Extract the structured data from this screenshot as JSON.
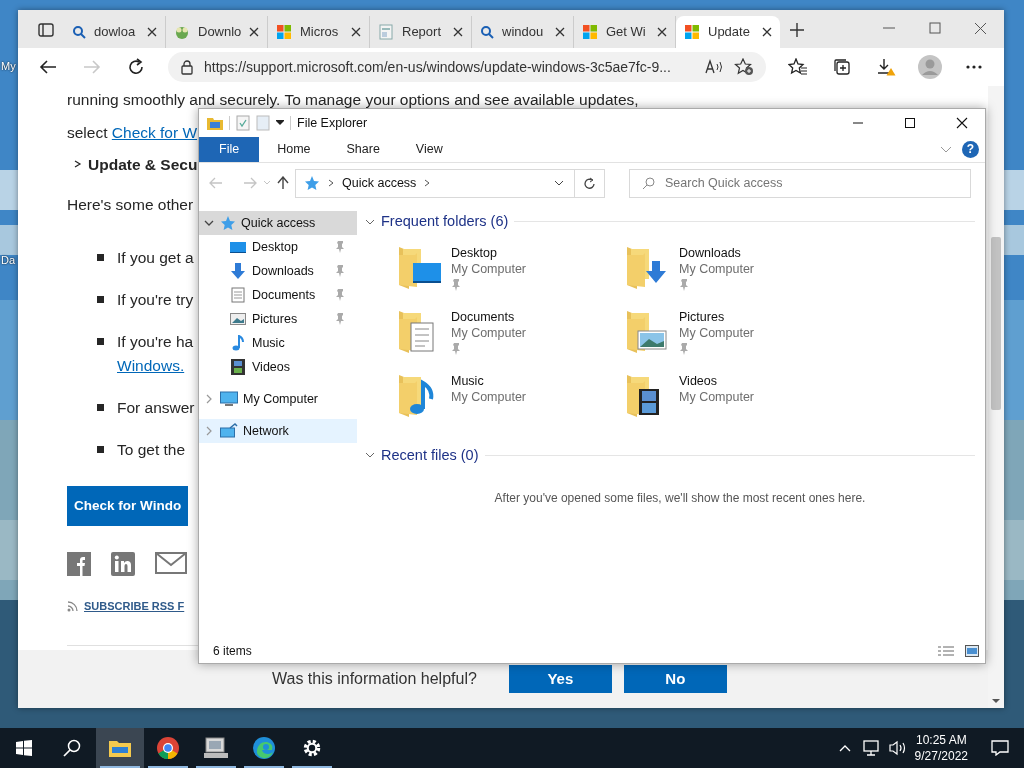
{
  "desktop": {
    "icon_labels": [
      "My",
      "Da"
    ]
  },
  "browser": {
    "tabs": [
      {
        "kind": "search",
        "title": "dowloa",
        "selected": false
      },
      {
        "kind": "mascot",
        "title": "Downlo",
        "selected": false
      },
      {
        "kind": "windows",
        "title": "Micros",
        "selected": false
      },
      {
        "kind": "document",
        "title": "Report",
        "selected": false
      },
      {
        "kind": "search",
        "title": "windou",
        "selected": false
      },
      {
        "kind": "windows",
        "title": "Get Wi",
        "selected": false
      },
      {
        "kind": "windows",
        "title": "Update",
        "selected": true
      }
    ],
    "forward_disabled": true,
    "address": "https://support.microsoft.com/en-us/windows/update-windows-3c5ae7fc-9...",
    "page": {
      "intro": "running smoothly and securely. To manage your options and see available updates,",
      "select_text": "select ",
      "select_link": "Check for W",
      "path": "Update & Secu",
      "lead": "Here's some other",
      "bullets": [
        {
          "text": "If you get a"
        },
        {
          "text": "If you're try"
        },
        {
          "text": "If you're ha",
          "link": "Windows."
        },
        {
          "text": "For answer"
        },
        {
          "text": "To get the"
        }
      ],
      "action_button": "Check for Windo",
      "subscribe": "SUBSCRIBE RSS F",
      "feedback": {
        "question": "Was this information helpful?",
        "buttons": [
          "Yes",
          "No"
        ]
      }
    }
  },
  "explorer": {
    "title": "File Explorer",
    "ribbon_tabs": [
      {
        "label": "File",
        "kind": "menu"
      },
      {
        "label": "Home",
        "kind": "tab"
      },
      {
        "label": "Share",
        "kind": "tab"
      },
      {
        "label": "View",
        "kind": "tab"
      }
    ],
    "help": "?",
    "address": "Quick access",
    "search_placeholder": "Search Quick access",
    "nav": [
      {
        "kind": "star",
        "label": "Quick access",
        "expanded": true,
        "selected": true,
        "hovered": false,
        "children": [
          {
            "kind": "desktop",
            "label": "Desktop",
            "pinned": true
          },
          {
            "kind": "downloads",
            "label": "Downloads",
            "pinned": true
          },
          {
            "kind": "documents",
            "label": "Documents",
            "pinned": true
          },
          {
            "kind": "pictures",
            "label": "Pictures",
            "pinned": true
          },
          {
            "kind": "music",
            "label": "Music",
            "pinned": false
          },
          {
            "kind": "videos",
            "label": "Videos",
            "pinned": false
          }
        ]
      },
      {
        "kind": "computer",
        "label": "My Computer",
        "expanded": false,
        "selected": false,
        "hovered": false
      },
      {
        "kind": "network",
        "label": "Network",
        "expanded": false,
        "selected": false,
        "hovered": true
      }
    ],
    "sections": [
      {
        "title": "Frequent folders (6)",
        "expanded": true,
        "folders": [
          {
            "kind": "desktop",
            "name": "Desktop",
            "location": "My Computer",
            "pinned": true
          },
          {
            "kind": "downloads",
            "name": "Downloads",
            "location": "My Computer",
            "pinned": true
          },
          {
            "kind": "documents",
            "name": "Documents",
            "location": "My Computer",
            "pinned": true
          },
          {
            "kind": "pictures",
            "name": "Pictures",
            "location": "My Computer",
            "pinned": true
          },
          {
            "kind": "music",
            "name": "Music",
            "location": "My Computer",
            "pinned": false
          },
          {
            "kind": "videos",
            "name": "Videos",
            "location": "My Computer",
            "pinned": false
          }
        ]
      },
      {
        "title": "Recent files (0)",
        "expanded": true,
        "message": "After you've opened some files, we'll show the most recent ones here."
      }
    ],
    "status": "6 items"
  },
  "taskbar": {
    "apps": [
      {
        "kind": "explorer",
        "running": true,
        "selected": true
      },
      {
        "kind": "chrome",
        "running": true,
        "selected": false
      },
      {
        "kind": "monitor",
        "running": true,
        "selected": false
      },
      {
        "kind": "edge",
        "running": true,
        "selected": false
      },
      {
        "kind": "settings",
        "running": true,
        "selected": false
      }
    ],
    "time": "10:25 AM",
    "date": "9/27/2022"
  }
}
